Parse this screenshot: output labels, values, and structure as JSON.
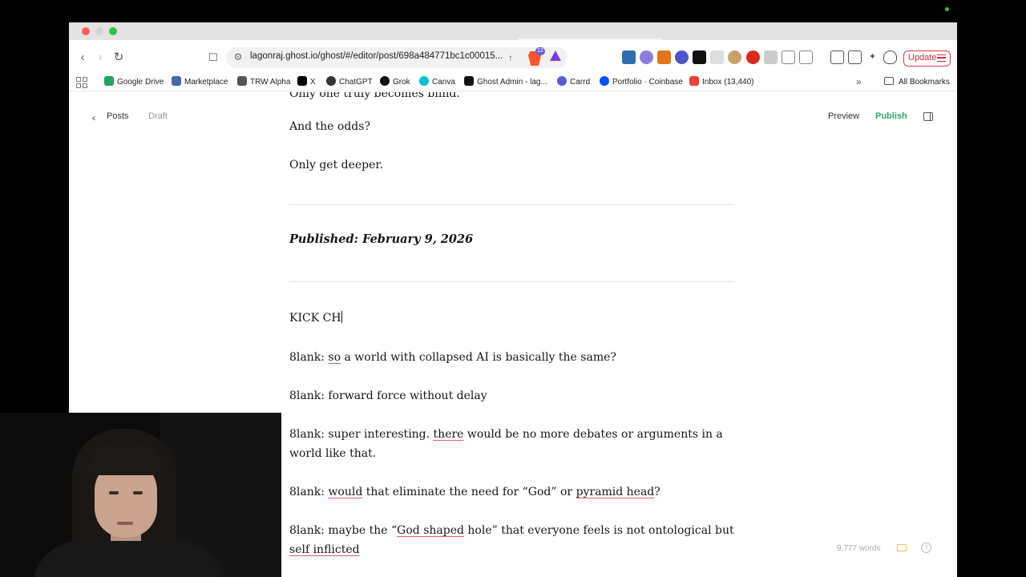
{
  "browser": {
    "url": "lagonraj.ghost.io/ghost/#/editor/post/698a484771bc1c00015...",
    "brave_badge": "12",
    "update_label": "Update"
  },
  "bookmarks": {
    "items": [
      {
        "label": "Google Drive",
        "color": "#1fa463"
      },
      {
        "label": "Marketplace",
        "color": "#4267b2"
      },
      {
        "label": "TRW Alpha",
        "color": "#555555"
      },
      {
        "label": "X",
        "color": "#000000"
      },
      {
        "label": "ChatGPT",
        "color": "#333333"
      },
      {
        "label": "Grok",
        "color": "#111111"
      },
      {
        "label": "Canva",
        "color": "#00c4cc"
      },
      {
        "label": "Ghost Admin - lag...",
        "color": "#111111"
      },
      {
        "label": "Carrd",
        "color": "#5a5ad6"
      },
      {
        "label": "Portfolio · Coinbase",
        "color": "#0052ff"
      },
      {
        "label": "Inbox (13,440)",
        "color": "#ea4335"
      }
    ],
    "all_bookmarks": "All Bookmarks"
  },
  "editor": {
    "back_label": "Posts",
    "status": "Draft",
    "preview_label": "Preview",
    "publish_label": "Publish",
    "word_count": "9,777 words"
  },
  "article": {
    "cut_line": "Only one truly becomes blind.",
    "p1": "And the odds?",
    "p2": "Only get deeper.",
    "published": "Published: February 9, 2026",
    "kick": "KICK CH",
    "chat": [
      {
        "speaker": "8lank:",
        "text": "so a world with collapsed AI is basically the same?"
      },
      {
        "speaker": "8lank:",
        "text": "forward force without delay"
      },
      {
        "speaker": "8lank:",
        "text": "super interesting. there would be no more debates or arguments in a world like that."
      },
      {
        "speaker": "8lank:",
        "text": "would that eliminate the need for “God” or pyramid head?"
      },
      {
        "speaker": "8lank:",
        "text": "maybe the “God shaped hole” that everyone feels is not ontological but self inflicted"
      }
    ]
  }
}
